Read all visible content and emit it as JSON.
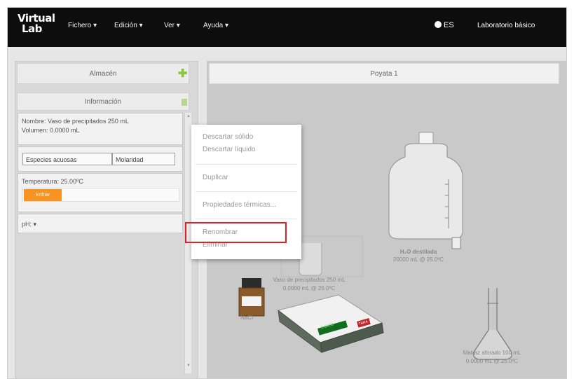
{
  "app": {
    "logo_line1": "Virtual",
    "logo_line2": "Lab"
  },
  "menu": [
    {
      "label": "Fichero ▾"
    },
    {
      "label": "Edición ▾"
    },
    {
      "label": "Ver ▾"
    },
    {
      "label": "Ayuda ▾"
    }
  ],
  "header_right": {
    "language": "ES",
    "lab_name": "Laboratorio básico"
  },
  "left_panel": {
    "store_title": "Almacén",
    "info_title": "Información",
    "name_line": "Nombre: Vaso de precipitados 250 mL",
    "volume_line": "Volumen: 0.0000 mL",
    "species_col": "Especies acuosas",
    "molarity_col": "Molaridad",
    "temperature": "Temperatura: 25.00ºC",
    "temp_button": "Enfriar",
    "ph": "pH: ▾"
  },
  "bench": {
    "title": "Poyata 1"
  },
  "context_menu": {
    "items": [
      "Descartar sólido",
      "Descartar líquido",
      "Duplicar",
      "Propiedades térmicas...",
      "Renombrar",
      "Eliminar"
    ]
  },
  "labels": {
    "bottle_name": "H₂O destilada",
    "bottle_detail": "20000 mL @ 25.0ºC",
    "beaker_name": "Vaso de precipitados 250 mL",
    "beaker_detail": "0.0000 mL @ 25.0ºC",
    "reagent_name": "NaCl",
    "flask_name": "Matraz aforado 100 mL",
    "flask_detail": "0.0000 mL @ 25.0ºC",
    "scale_display": "0.0000",
    "scale_button": "TARA"
  },
  "colors": {
    "topbar": "#0d0d0d",
    "accent_orange": "#f7931e",
    "accent_green": "#8cc63f",
    "highlight_red": "#e41e26"
  }
}
